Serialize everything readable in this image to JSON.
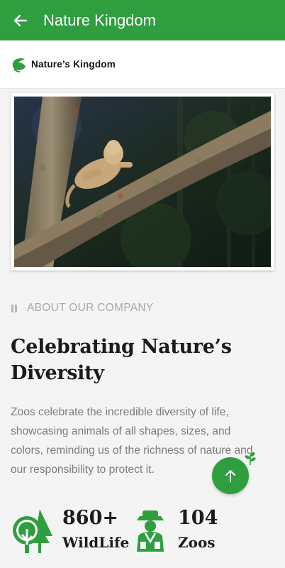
{
  "appbar": {
    "title": "Nature Kingdom",
    "back_icon": "arrow-left-icon"
  },
  "brand": {
    "name": "Nature’s Kingdom",
    "logo_icon": "rabbit-logo-icon"
  },
  "hero": {
    "image": "lioness-resting-on-tree-branch"
  },
  "about": {
    "eyebrow": "ABOUT OUR COMPANY",
    "heading_line1": "Celebrating Nature’s",
    "heading_line2": "Diversity",
    "description": "Zoos celebrate the incredible diversity of life, showcasing animals of all shapes, sizes, and colors, reminding us of the richness of nature and our responsibility to protect it."
  },
  "fab": {
    "icon": "arrow-up-icon"
  },
  "stats": [
    {
      "number": "860+",
      "label": "WildLife",
      "icon": "trees-icon"
    },
    {
      "number": "104",
      "label": "Zoos",
      "icon": "zookeeper-icon"
    }
  ],
  "colors": {
    "primary": "#2e9e3f",
    "text": "#1b1b1b",
    "muted": "#7c7c7c"
  }
}
